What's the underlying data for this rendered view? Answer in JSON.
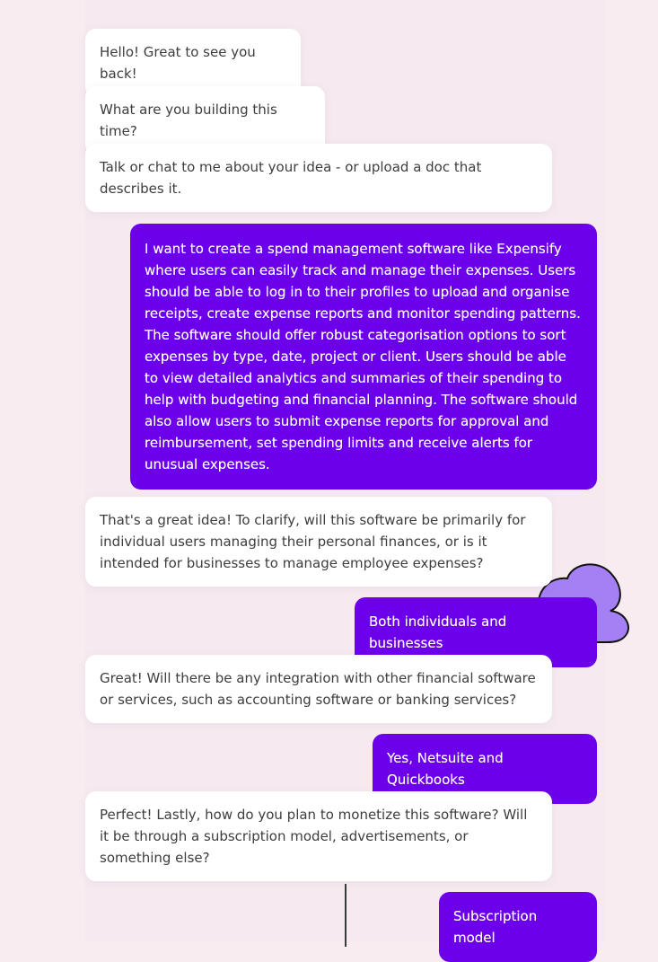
{
  "colors": {
    "page_background": "#f8ecf1",
    "assistant_bubble": "#ffffff",
    "user_bubble": "#6c00ea",
    "cloud_fill": "#a57ff4"
  },
  "decorations": {
    "cloud_icon": "cloud-icon"
  },
  "messages": [
    {
      "role": "assistant",
      "text": "Hello! Great to see you back!"
    },
    {
      "role": "assistant",
      "text": "What are you building this time?"
    },
    {
      "role": "assistant",
      "text": "Talk or chat to me about your idea - or upload a doc that describes it."
    },
    {
      "role": "user",
      "text": "I want to create a spend management software like Expensify where users can easily track and manage their expenses. Users should be able to log in to their profiles to upload and organise receipts, create expense reports and monitor spending patterns. The software should offer robust categorisation options to sort expenses by type, date, project or client. Users should be able to view detailed analytics and summaries of their spending to help with budgeting and financial planning. The software should also allow users to submit expense reports for approval and reimbursement, set spending limits and receive alerts for unusual expenses."
    },
    {
      "role": "assistant",
      "text": "That's a great idea! To clarify, will this software be primarily for individual users managing their personal finances, or is it intended for businesses to manage employee expenses?"
    },
    {
      "role": "user",
      "text": "Both individuals and businesses"
    },
    {
      "role": "assistant",
      "text": "Great! Will there be any integration with other financial software or services, such as accounting software or banking services?"
    },
    {
      "role": "user",
      "text": "Yes, Netsuite and Quickbooks"
    },
    {
      "role": "assistant",
      "text": "Perfect! Lastly, how do you plan to monetize this software? Will it be through a subscription model, advertisements, or something else?"
    },
    {
      "role": "user",
      "text": "Subscription model"
    }
  ]
}
